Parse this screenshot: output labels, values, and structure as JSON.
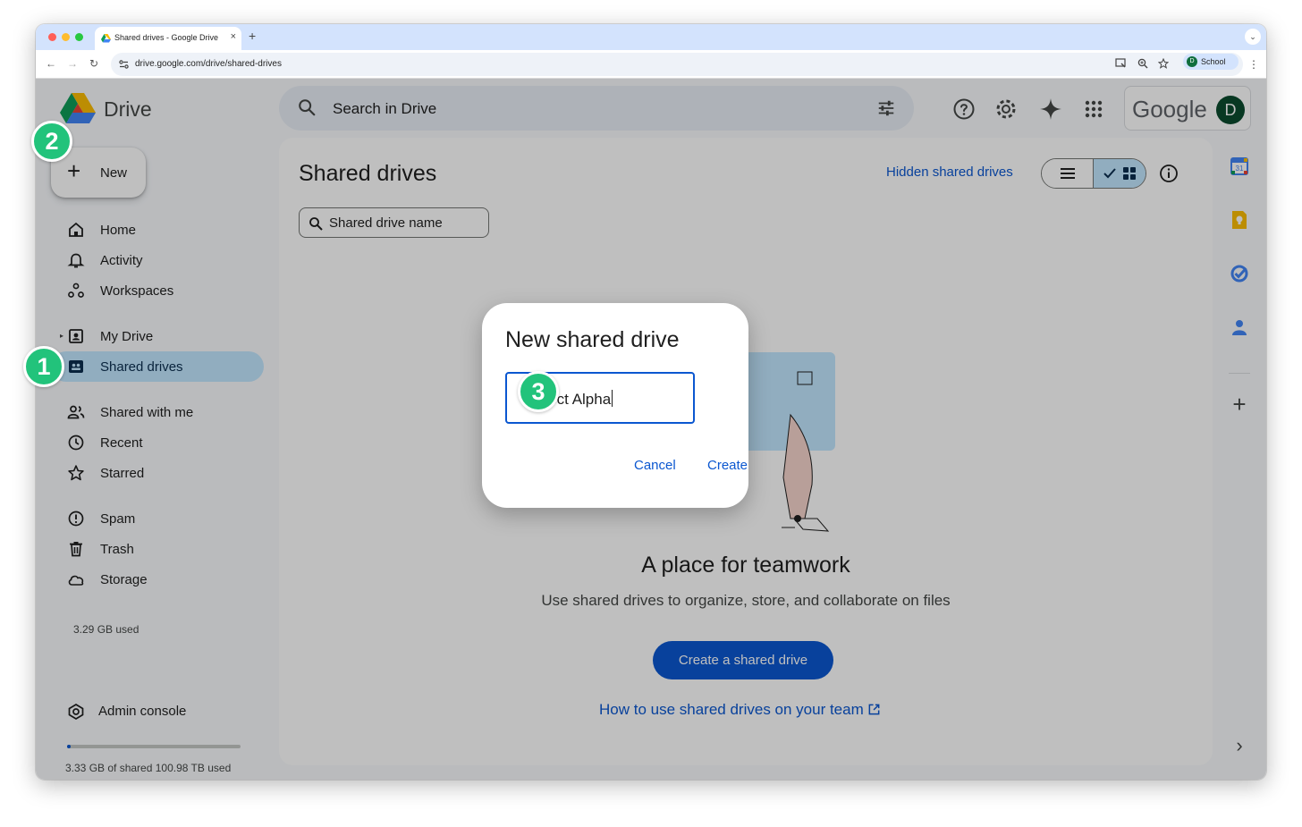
{
  "browser": {
    "tab_title": "Shared drives - Google Drive",
    "tab_close": "×",
    "new_tab": "+",
    "tab_menu": "⌄",
    "back": "←",
    "forward": "→",
    "reload": "↻",
    "url": "drive.google.com/drive/shared-drives",
    "profile_initial": "D",
    "profile_label": "School",
    "menu": "⋮"
  },
  "app": {
    "title": "Drive",
    "search_placeholder": "Search in Drive",
    "google_word": "Google",
    "avatar_initial": "D"
  },
  "sidebar": {
    "new_label": "New",
    "new_icon": "+",
    "items": [
      {
        "label": "Home",
        "icon": "home-icon"
      },
      {
        "label": "Activity",
        "icon": "bell-icon"
      },
      {
        "label": "Workspaces",
        "icon": "workspaces-icon"
      },
      {
        "label": "My Drive",
        "icon": "my-drive-icon"
      },
      {
        "label": "Shared drives",
        "icon": "shared-drives-icon"
      },
      {
        "label": "Shared with me",
        "icon": "people-icon"
      },
      {
        "label": "Recent",
        "icon": "clock-icon"
      },
      {
        "label": "Starred",
        "icon": "star-icon"
      },
      {
        "label": "Spam",
        "icon": "spam-icon"
      },
      {
        "label": "Trash",
        "icon": "trash-icon"
      },
      {
        "label": "Storage",
        "icon": "cloud-icon"
      }
    ],
    "my_drive_caret": "▸",
    "storage_used": "3.29 GB used",
    "admin_label": "Admin console",
    "quota_fraction": 0.02,
    "quota_text": "3.33 GB of shared 100.98 TB used"
  },
  "main": {
    "title": "Shared drives",
    "hidden_link": "Hidden shared drives",
    "filter_label": "Shared drive name",
    "empty_title": "A place for teamwork",
    "empty_subtitle": "Use shared drives to organize, store, and collaborate on files",
    "create_button": "Create a shared drive",
    "help_link": "How to use shared drives on your team"
  },
  "rightbar": {
    "calendar_day": "31",
    "add": "+",
    "expand": "›"
  },
  "dialog": {
    "title": "New shared drive",
    "input_value": "Project Alpha",
    "cancel_label": "Cancel",
    "create_label": "Create"
  },
  "markers": [
    "1",
    "2",
    "3"
  ],
  "colors": {
    "accent": "#0b57d0",
    "nav_active": "#c2e7ff",
    "marker": "#22c37b"
  }
}
